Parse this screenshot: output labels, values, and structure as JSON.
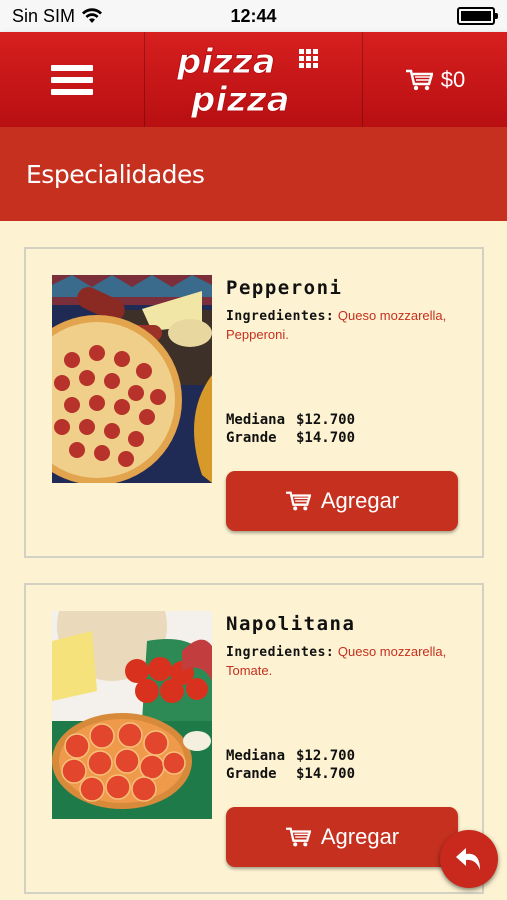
{
  "status_bar": {
    "carrier": "Sin SIM",
    "time": "12:44"
  },
  "header": {
    "logo_text_top": "pizza",
    "logo_text_bottom": "pizza",
    "cart_total": "$0",
    "menu_icon": "hamburger-icon",
    "cart_icon": "cart-icon"
  },
  "section": {
    "title": "Especialidades"
  },
  "colors": {
    "brand_red": "#c5301f",
    "header_red": "#d71f1f",
    "background": "#fdf3d2"
  },
  "products": [
    {
      "name": "Pepperoni",
      "ingredients_label": "Ingredientes:",
      "ingredients": "Queso mozzarella, Pepperoni.",
      "prices": [
        {
          "size": "Mediana",
          "price": "$12.700"
        },
        {
          "size": "Grande",
          "price": "$14.700"
        }
      ],
      "add_label": "Agregar"
    },
    {
      "name": "Napolitana",
      "ingredients_label": "Ingredientes:",
      "ingredients": "Queso mozzarella, Tomate.",
      "prices": [
        {
          "size": "Mediana",
          "price": "$12.700"
        },
        {
          "size": "Grande",
          "price": "$14.700"
        }
      ],
      "add_label": "Agregar"
    }
  ],
  "back_button": {
    "icon": "back-arrow-icon"
  }
}
